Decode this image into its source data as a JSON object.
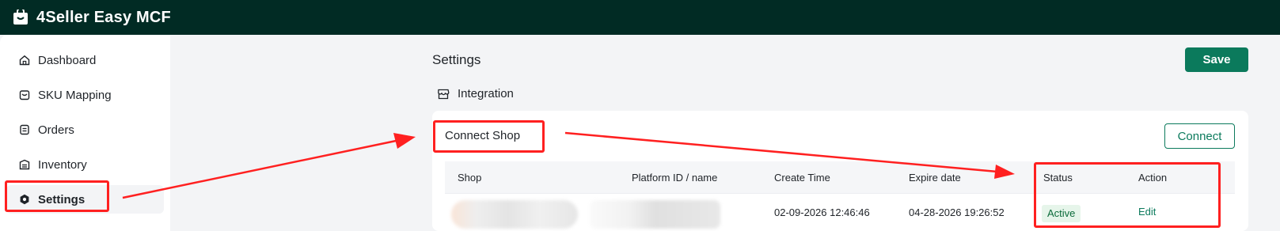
{
  "app": {
    "title": "4Seller Easy MCF"
  },
  "sidebar": {
    "items": [
      {
        "label": "Dashboard",
        "icon": "home-icon"
      },
      {
        "label": "SKU Mapping",
        "icon": "sku-mapping-icon"
      },
      {
        "label": "Orders",
        "icon": "orders-icon"
      },
      {
        "label": "Inventory",
        "icon": "inventory-icon"
      },
      {
        "label": "Settings",
        "icon": "settings-icon",
        "active": true
      }
    ]
  },
  "page": {
    "title": "Settings",
    "save_label": "Save",
    "section": {
      "label": "Integration",
      "icon": "store-icon"
    },
    "card": {
      "title": "Connect Shop",
      "connect_label": "Connect",
      "table": {
        "columns": [
          "Shop",
          "Platform ID / name",
          "Create Time",
          "Expire date",
          "Status",
          "Action"
        ],
        "rows": [
          {
            "create_time": "02-09-2026 12:46:46",
            "expire_date": "04-28-2026 19:26:52",
            "status": "Active",
            "action": "Edit"
          }
        ]
      }
    }
  },
  "colors": {
    "topbar": "#012b24",
    "accent": "#0b7a5c",
    "annotation": "#ff2020",
    "status_active_bg": "#e6f5ea"
  }
}
